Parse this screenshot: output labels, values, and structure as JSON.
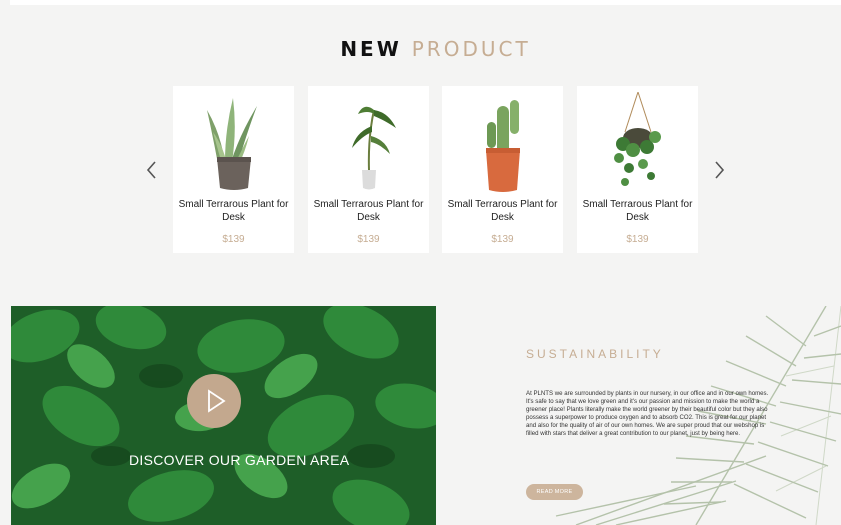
{
  "header": {
    "title_part1": "NEW",
    "title_part2": "PRODUCT"
  },
  "carousel": {
    "prev_icon": "chevron-left-icon",
    "next_icon": "chevron-right-icon"
  },
  "products": [
    {
      "name": "Small Terrarous Plant for Desk",
      "price": "$139",
      "icon": "snake-plant-icon"
    },
    {
      "name": "Small Terrarous Plant for Desk",
      "price": "$139",
      "icon": "palm-seedling-icon"
    },
    {
      "name": "Small Terrarous Plant for Desk",
      "price": "$139",
      "icon": "cactus-icon"
    },
    {
      "name": "Small Terrarous Plant for Desk",
      "price": "$139",
      "icon": "hanging-plant-icon"
    }
  ],
  "garden": {
    "label": "DISCOVER OUR GARDEN AREA",
    "play_icon": "play-icon"
  },
  "sustainability": {
    "title": "SUSTAINABILITY",
    "text": "At PLNTS we are surrounded by plants in our nursery, in our office and in our own homes. It's safe to say that we love green and it's our passion and mission to make the world a greener place! Plants literally make the world greener by their beautiful color but they also possess a superpower to produce oxygen and to absorb CO2. This is great for our planet and also for the quality of air of our own homes. We are super proud that our webshop is filled with stars that deliver a great contribution to our planet, just by being here.",
    "button": "READ MORE"
  },
  "colors": {
    "accent": "#c6ad93",
    "background": "#f4f4f3",
    "card": "#ffffff",
    "button": "#cdb59d"
  }
}
